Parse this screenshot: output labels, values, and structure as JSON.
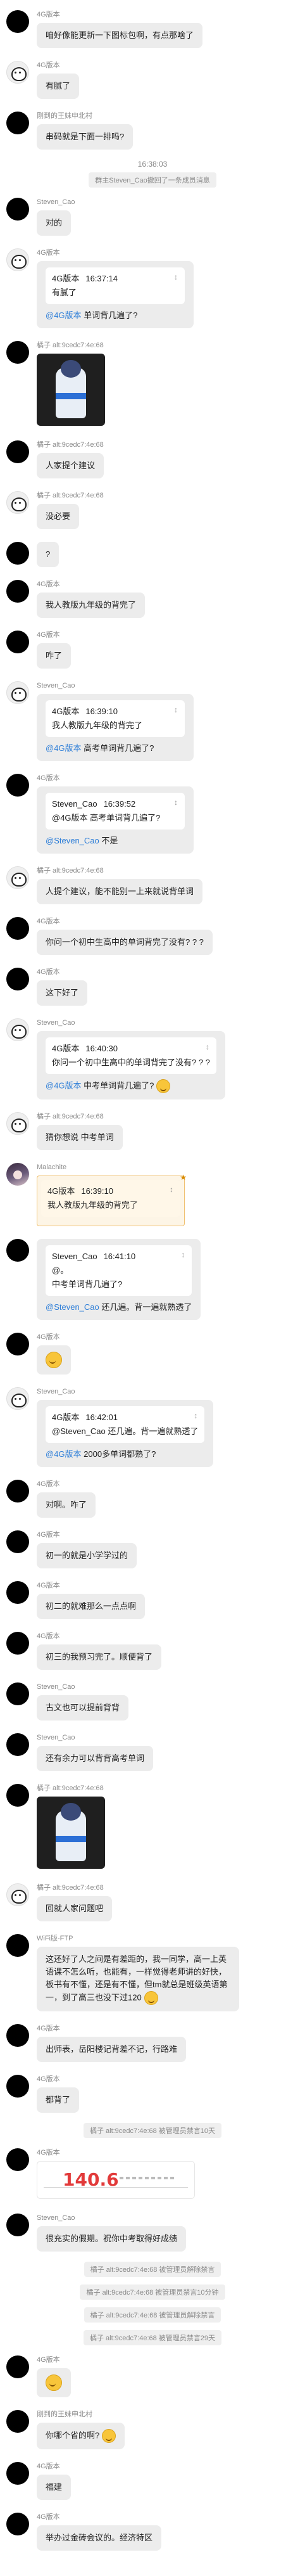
{
  "messages": [
    {
      "type": "msg",
      "avatar": "black",
      "sender": "4G版本",
      "text": "咱好像能更新一下图标包啊，有点那啥了"
    },
    {
      "type": "msg",
      "avatar": "cat",
      "sender": "4G版本",
      "text": "有腻了"
    },
    {
      "type": "msg",
      "avatar": "black",
      "sender": "刚到的王妹申北村",
      "text": "串码就是下面一排吗?"
    },
    {
      "type": "system",
      "time": "16:38:03",
      "text": "群主Steven_Cao撤回了一条成员消息"
    },
    {
      "type": "msg",
      "avatar": "black",
      "sender": "Steven_Cao",
      "text": "对的"
    },
    {
      "type": "quote",
      "avatar": "cat",
      "sender": "4G版本",
      "q_name": "4G版本",
      "q_time": "16:37:14",
      "q_text": "有腻了",
      "mention": "@4G版本",
      "text": "单词背几遍了?"
    },
    {
      "type": "sticker",
      "avatar": "black",
      "sender": "橘子 alt:9cedc7:4e:68"
    },
    {
      "type": "msg",
      "avatar": "black",
      "sender": "橘子 alt:9cedc7:4e:68",
      "text": "人家提个建议"
    },
    {
      "type": "msg",
      "avatar": "cat",
      "sender": "橘子 alt:9cedc7:4e:68",
      "text": "没必要"
    },
    {
      "type": "msg",
      "avatar": "black",
      "sender": "",
      "text": "?"
    },
    {
      "type": "msg",
      "avatar": "black",
      "sender": "4G版本",
      "text": "我人教版九年级的背完了"
    },
    {
      "type": "msg",
      "avatar": "black",
      "sender": "4G版本",
      "text": "咋了"
    },
    {
      "type": "quote",
      "avatar": "cat",
      "sender": "Steven_Cao",
      "q_name": "4G版本",
      "q_time": "16:39:10",
      "q_text": "我人教版九年级的背完了",
      "mention": "@4G版本",
      "text": "高考单词背几遍了?"
    },
    {
      "type": "quote",
      "avatar": "black",
      "sender": "4G版本",
      "q_name": "Steven_Cao",
      "q_time": "16:39:52",
      "q_text": "@4G版本 高考单词背几遍了?",
      "mention": "@Steven_Cao",
      "text": "不是"
    },
    {
      "type": "msg",
      "avatar": "cat",
      "sender": "橘子 alt:9cedc7:4e:68",
      "text": "人提个建议，能不能别一上来就说背单词"
    },
    {
      "type": "msg",
      "avatar": "black",
      "sender": "4G版本",
      "text": "你问一个初中生高中的单词背完了没有? ? ?"
    },
    {
      "type": "msg",
      "avatar": "black",
      "sender": "4G版本",
      "text": "这下好了"
    },
    {
      "type": "quote",
      "avatar": "cat",
      "sender": "Steven_Cao",
      "q_name": "4G版本",
      "q_time": "16:40:30",
      "q_text": "你问一个初中生高中的单词背完了没有? ? ?",
      "mention": "@4G版本",
      "text": "中考单词背几遍了?",
      "emoji": true
    },
    {
      "type": "msg",
      "avatar": "cat",
      "sender": "橘子 alt:9cedc7:4e:68",
      "text": "猜你想说 中考单词"
    },
    {
      "type": "pinned",
      "avatar": "anime",
      "sender": "Malachite",
      "q_name": "4G版本",
      "q_time": "16:39:10",
      "q_text": "我人教版九年级的背完了"
    },
    {
      "type": "quote2",
      "avatar": "black",
      "sender": "",
      "q_name": "Steven_Cao",
      "q_time": "16:41:10",
      "q_lines": [
        "@。",
        "中考单词背几遍了?"
      ],
      "mention": "@Steven_Cao",
      "text": "还几遍。背一遍就熟透了"
    },
    {
      "type": "emoji",
      "avatar": "black",
      "sender": "4G版本"
    },
    {
      "type": "quote",
      "avatar": "cat",
      "sender": "Steven_Cao",
      "q_name": "4G版本",
      "q_time": "16:42:01",
      "q_text": "@Steven_Cao 还几遍。背一遍就熟透了",
      "mention": "@4G版本",
      "text": "2000多单词都熟了?"
    },
    {
      "type": "msg",
      "avatar": "black",
      "sender": "4G版本",
      "text": "对啊。咋了"
    },
    {
      "type": "msg",
      "avatar": "black",
      "sender": "4G版本",
      "text": "初一的就是小学学过的"
    },
    {
      "type": "msg",
      "avatar": "black",
      "sender": "4G版本",
      "text": "初二的就难那么一点点啊"
    },
    {
      "type": "msg",
      "avatar": "black",
      "sender": "4G版本",
      "text": "初三的我预习完了。顺便背了"
    },
    {
      "type": "msg",
      "avatar": "black",
      "sender": "Steven_Cao",
      "text": "古文也可以提前背背"
    },
    {
      "type": "msg",
      "avatar": "black",
      "sender": "Steven_Cao",
      "text": "还有余力可以背背高考单词"
    },
    {
      "type": "sticker",
      "avatar": "black",
      "sender": "橘子 alt:9cedc7:4e:68"
    },
    {
      "type": "msg",
      "avatar": "cat",
      "sender": "橘子 alt:9cedc7:4e:68",
      "text": "回就人家问题吧"
    },
    {
      "type": "msg",
      "avatar": "black",
      "sender": "WiFi版-FTP",
      "text": "这还好了人之间是有差距的，我一同学，高一上英语课不怎么听，也能有，一样觉得老师讲的好快，板书有不懂，还是有不懂，但tm就总是班级英语第一，到了高三也没下过120",
      "emoji": true,
      "wide": true
    },
    {
      "type": "msg",
      "avatar": "black",
      "sender": "4G版本",
      "text": "出师表，岳阳楼记背差不记，行路难"
    },
    {
      "type": "msg",
      "avatar": "black",
      "sender": "4G版本",
      "text": "都背了"
    },
    {
      "type": "notice",
      "text": "橘子 alt:9cedc7:4e:68 被管理员禁言10天"
    },
    {
      "type": "image",
      "avatar": "black",
      "sender": "4G版本",
      "price": "140.6"
    },
    {
      "type": "msg",
      "avatar": "black",
      "sender": "Steven_Cao",
      "text": "很充实的假期。祝你中考取得好成绩"
    },
    {
      "type": "notice",
      "text": "橘子 alt:9cedc7:4e:68 被管理员解除禁言"
    },
    {
      "type": "notice",
      "text": "橘子 alt:9cedc7:4e:68 被管理员禁言10分钟"
    },
    {
      "type": "notice",
      "text": "橘子 alt:9cedc7:4e:68 被管理员解除禁言"
    },
    {
      "type": "notice",
      "text": "橘子 alt:9cedc7:4e:68 被管理员禁言29天"
    },
    {
      "type": "emoji",
      "avatar": "black",
      "sender": "4G版本"
    },
    {
      "type": "msg",
      "avatar": "black",
      "sender": "刚到的王妹申北村",
      "text": "你哪个省的啊?",
      "emoji": true
    },
    {
      "type": "msg",
      "avatar": "black",
      "sender": "4G版本",
      "text": "福建"
    },
    {
      "type": "msg",
      "avatar": "black",
      "sender": "4G版本",
      "text": "举办过金砖会议的。经济特区"
    }
  ]
}
